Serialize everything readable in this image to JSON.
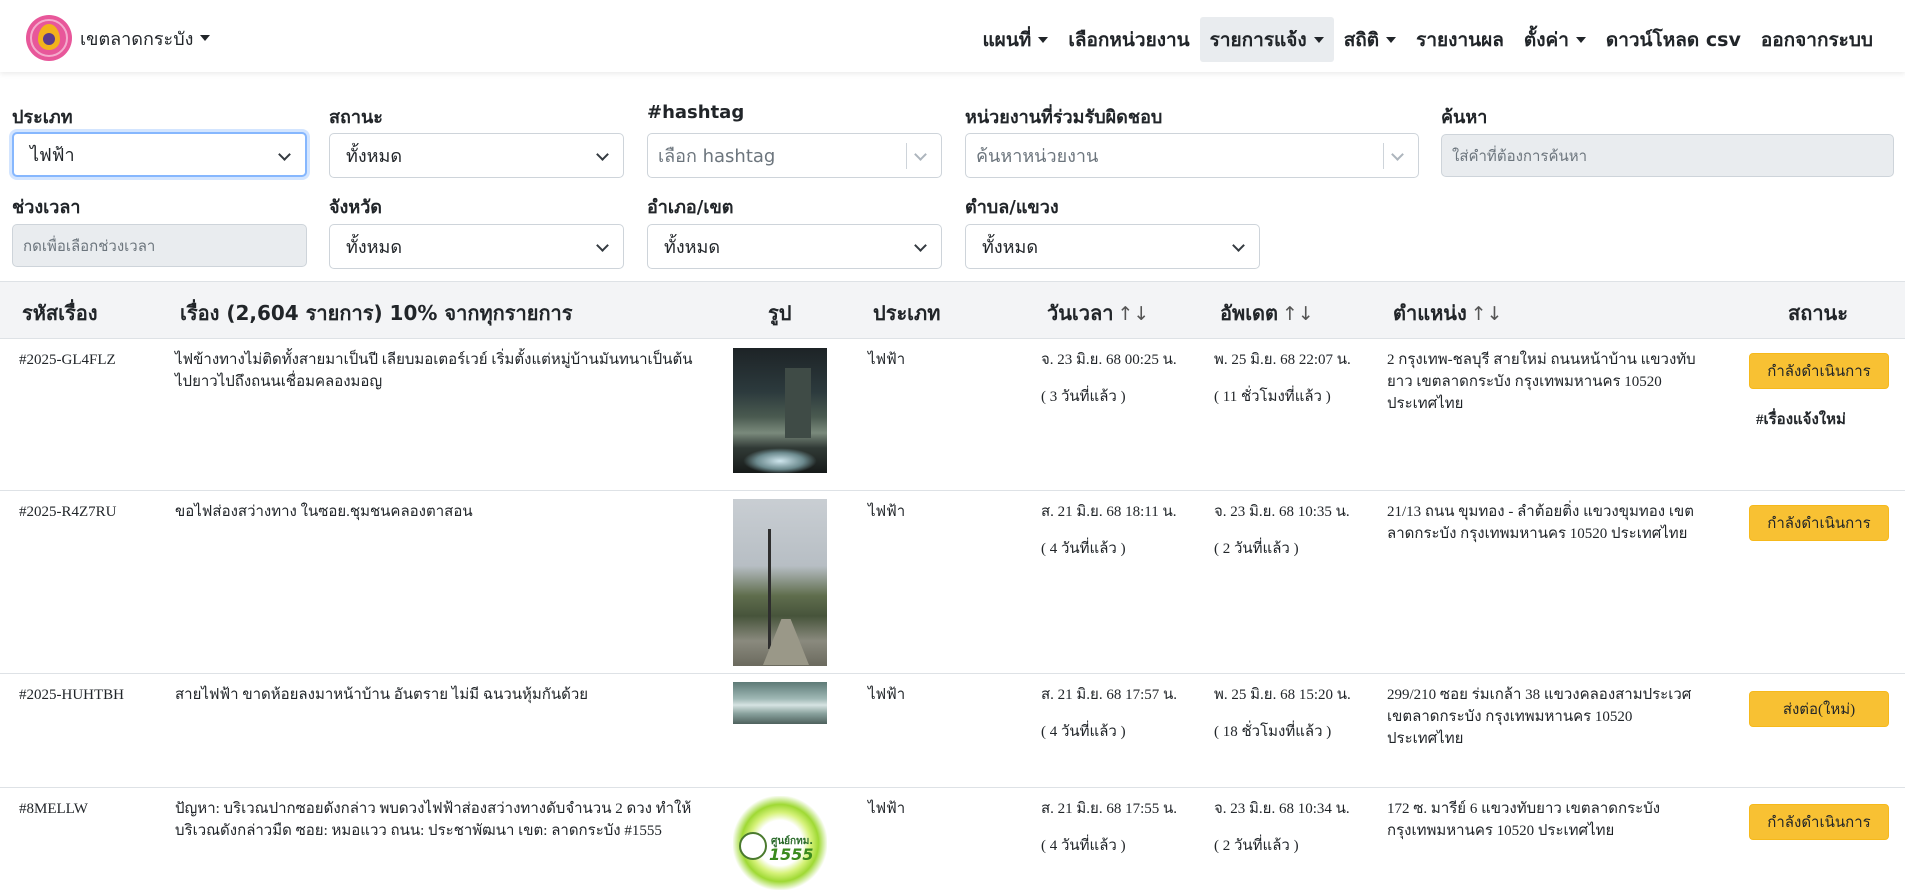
{
  "navbar": {
    "brand_label": "เขตลาดกระบัง",
    "items": [
      {
        "label": "แผนที่",
        "dropdown": true,
        "active": false
      },
      {
        "label": "เลือกหน่วยงาน",
        "dropdown": false,
        "active": false
      },
      {
        "label": "รายการแจ้ง",
        "dropdown": true,
        "active": true
      },
      {
        "label": "สถิติ",
        "dropdown": true,
        "active": false
      },
      {
        "label": "รายงานผล",
        "dropdown": false,
        "active": false
      },
      {
        "label": "ตั้งค่า",
        "dropdown": true,
        "active": false
      },
      {
        "label": "ดาวน์โหลด csv",
        "dropdown": false,
        "active": false
      },
      {
        "label": "ออกจากระบบ",
        "dropdown": false,
        "active": false
      }
    ]
  },
  "filters": {
    "type": {
      "label": "ประเภท",
      "value": "ไฟฟ้า"
    },
    "status": {
      "label": "สถานะ",
      "value": "ทั้งหมด"
    },
    "hashtag": {
      "label": "#hashtag",
      "placeholder": "เลือก hashtag"
    },
    "agency": {
      "label": "หน่วยงานที่ร่วมรับผิดชอบ",
      "placeholder": "ค้นหาหน่วยงาน"
    },
    "search": {
      "label": "ค้นหา",
      "placeholder": "ใส่คำที่ต้องการค้นหา"
    },
    "time_range": {
      "label": "ช่วงเวลา",
      "placeholder": "กดเพื่อเลือกช่วงเวลา"
    },
    "province": {
      "label": "จังหวัด",
      "value": "ทั้งหมด"
    },
    "district": {
      "label": "อำเภอ/เขต",
      "value": "ทั้งหมด"
    },
    "subdistrict": {
      "label": "ตำบล/แขวง",
      "value": "ทั้งหมด"
    }
  },
  "table": {
    "headers": {
      "id": "รหัสเรื่อง",
      "title": "เรื่อง (2,604 รายการ) 10% จากทุกรายการ",
      "image": "รูป",
      "type": "ประเภท",
      "datetime": "วันเวลา",
      "updated": "อัพเดต",
      "location": "ตำแหน่ง",
      "status": "สถานะ",
      "sort_icon": "↑↓"
    },
    "rows": [
      {
        "id": "#2025-GL4FLZ",
        "title": "ไฟข้างทางไม่ติดทั้งสายมาเป็นปี เลียบมอเตอร์เวย์ เริ่มตั้งแต่หมู่บ้านมันทนาเป็นต้นไปยาวไปถึงถนนเชื่อมคลองมอญ",
        "type": "ไฟฟ้า",
        "datetime": "จ. 23 มิ.ย. 68 00:25 น.",
        "datetime_ago": "( 3 วันที่แล้ว )",
        "updated": "พ. 25 มิ.ย. 68 22:07 น.",
        "updated_ago": "( 11 ชั่วโมงที่แล้ว )",
        "location": "2 กรุงเทพ-ชลบุรี สายใหม่ ถนนหน้าบ้าน แขวงทับยาว เขตลาดกระบัง กรุงเทพมหานคร 10520 ประเทศไทย",
        "status": "กำลังดำเนินการ",
        "hashtag": "#เรื่องแจ้งใหม่"
      },
      {
        "id": "#2025-R4Z7RU",
        "title": "ขอไฟส่องสว่างทาง ในซอย.ชุมชนคลองตาสอน",
        "type": "ไฟฟ้า",
        "datetime": "ส. 21 มิ.ย. 68 18:11 น.",
        "datetime_ago": "( 4 วันที่แล้ว )",
        "updated": "จ. 23 มิ.ย. 68 10:35 น.",
        "updated_ago": "( 2 วันที่แล้ว )",
        "location": "21/13 ถนน ขุมทอง - ลำต้อยติ่ง แขวงขุมทอง เขตลาดกระบัง กรุงเทพมหานคร 10520 ประเทศไทย",
        "status": "กำลังดำเนินการ",
        "hashtag": ""
      },
      {
        "id": "#2025-HUHTBH",
        "title": "สายไฟฟ้า ขาดห้อยลงมาหน้าบ้าน อันตราย ไม่มี ฉนวนหุ้มกันด้วย",
        "type": "ไฟฟ้า",
        "datetime": "ส. 21 มิ.ย. 68 17:57 น.",
        "datetime_ago": "( 4 วันที่แล้ว )",
        "updated": "พ. 25 มิ.ย. 68 15:20 น.",
        "updated_ago": "( 18 ชั่วโมงที่แล้ว )",
        "location": "299/210 ซอย ร่มเกล้า 38 แขวงคลองสามประเวศ เขตลาดกระบัง กรุงเทพมหานคร 10520 ประเทศไทย",
        "status": "ส่งต่อ(ใหม่)",
        "hashtag": ""
      },
      {
        "id": "#8MELLW",
        "title": "ปัญหา: บริเวณปากซอยดังกล่าว พบดวงไฟฟ้าส่องสว่างทางดับจำนวน 2 ดวง ทำให้บริเวณดังกล่าวมืด ซอย: หมอแวว ถนน: ประชาพัฒนา เขต: ลาดกระบัง #1555",
        "type": "ไฟฟ้า",
        "datetime": "ส. 21 มิ.ย. 68 17:55 น.",
        "datetime_ago": "( 4 วันที่แล้ว )",
        "updated": "จ. 23 มิ.ย. 68 10:34 น.",
        "updated_ago": "( 2 วันที่แล้ว )",
        "location": "172 ซ. มารีย์ 6 แขวงทับยาว เขตลาดกระบัง กรุงเทพมหานคร 10520 ประเทศไทย",
        "status": "กำลังดำเนินการ",
        "hashtag": "",
        "thumb_text": "ศูนย์กทม.",
        "thumb_number": "1555"
      }
    ]
  },
  "colors": {
    "status_button": "#f8c133",
    "active_nav": "#e9ecef",
    "brand_logo": "#e8579a"
  }
}
